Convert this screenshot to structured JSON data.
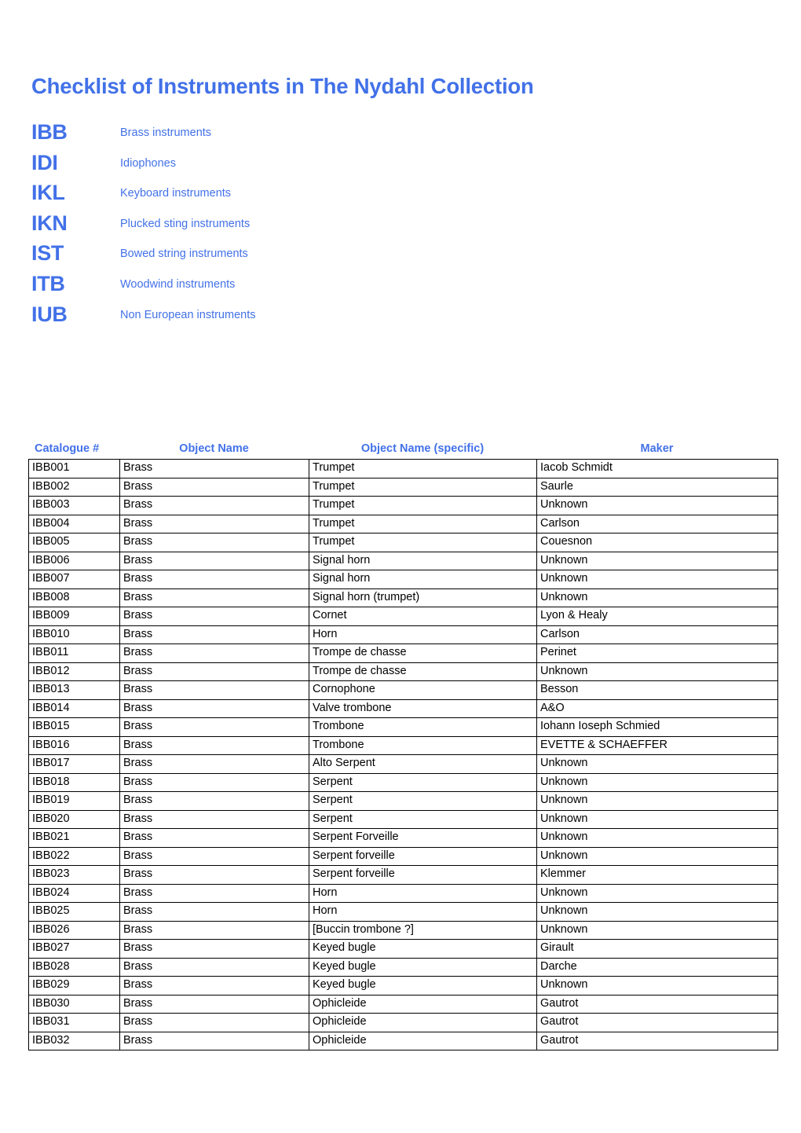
{
  "document": {
    "title": "Checklist of Instruments in The Nydahl Collection",
    "accent_color": "#4271e8",
    "text_color": "#000000",
    "background_color": "#ffffff"
  },
  "legend": {
    "items": [
      {
        "code": "IBB",
        "label": "Brass instruments"
      },
      {
        "code": "IDI",
        "label": "Idiophones"
      },
      {
        "code": "IKL",
        "label": "Keyboard instruments"
      },
      {
        "code": "IKN",
        "label": "Plucked sting instruments"
      },
      {
        "code": "IST",
        "label": "Bowed string instruments"
      },
      {
        "code": "ITB",
        "label": "Woodwind instruments"
      },
      {
        "code": "IUB",
        "label": "Non European instruments"
      }
    ]
  },
  "table": {
    "headers": [
      "Catalogue #",
      "Object Name",
      "Object Name (specific)",
      "Maker"
    ],
    "rows": [
      [
        "IBB001",
        "Brass",
        "Trumpet",
        "Iacob Schmidt"
      ],
      [
        "IBB002",
        "Brass",
        "Trumpet",
        "Saurle"
      ],
      [
        "IBB003",
        "Brass",
        "Trumpet",
        "Unknown"
      ],
      [
        "IBB004",
        "Brass",
        "Trumpet",
        "Carlson"
      ],
      [
        "IBB005",
        "Brass",
        "Trumpet",
        "Couesnon"
      ],
      [
        "IBB006",
        "Brass",
        "Signal horn",
        "Unknown"
      ],
      [
        "IBB007",
        "Brass",
        "Signal horn",
        "Unknown"
      ],
      [
        "IBB008",
        "Brass",
        "Signal horn (trumpet)",
        "Unknown"
      ],
      [
        "IBB009",
        "Brass",
        "Cornet",
        "Lyon & Healy"
      ],
      [
        "IBB010",
        "Brass",
        "Horn",
        "Carlson"
      ],
      [
        "IBB011",
        "Brass",
        "Trompe de chasse",
        "Perinet"
      ],
      [
        "IBB012",
        "Brass",
        "Trompe de chasse",
        "Unknown"
      ],
      [
        "IBB013",
        "Brass",
        "Cornophone",
        "Besson"
      ],
      [
        "IBB014",
        "Brass",
        "Valve trombone",
        "A&O"
      ],
      [
        "IBB015",
        "Brass",
        "Trombone",
        "Iohann Ioseph Schmied"
      ],
      [
        "IBB016",
        "Brass",
        "Trombone",
        "EVETTE & SCHAEFFER"
      ],
      [
        "IBB017",
        "Brass",
        "Alto Serpent",
        "Unknown"
      ],
      [
        "IBB018",
        "Brass",
        "Serpent",
        "Unknown"
      ],
      [
        "IBB019",
        "Brass",
        "Serpent",
        "Unknown"
      ],
      [
        "IBB020",
        "Brass",
        "Serpent",
        "Unknown"
      ],
      [
        "IBB021",
        "Brass",
        "Serpent Forveille",
        "Unknown"
      ],
      [
        "IBB022",
        "Brass",
        "Serpent forveille",
        "Unknown"
      ],
      [
        "IBB023",
        "Brass",
        "Serpent forveille",
        "Klemmer"
      ],
      [
        "IBB024",
        "Brass",
        "Horn",
        "Unknown"
      ],
      [
        "IBB025",
        "Brass",
        "Horn",
        "Unknown"
      ],
      [
        "IBB026",
        "Brass",
        "[Buccin trombone ?]",
        "Unknown"
      ],
      [
        "IBB027",
        "Brass",
        "Keyed bugle",
        "Girault"
      ],
      [
        "IBB028",
        "Brass",
        "Keyed bugle",
        "Darche"
      ],
      [
        "IBB029",
        "Brass",
        "Keyed bugle",
        "Unknown"
      ],
      [
        "IBB030",
        "Brass",
        "Ophicleide",
        "Gautrot"
      ],
      [
        "IBB031",
        "Brass",
        "Ophicleide",
        "Gautrot"
      ],
      [
        "IBB032",
        "Brass",
        "Ophicleide",
        "Gautrot"
      ]
    ]
  }
}
